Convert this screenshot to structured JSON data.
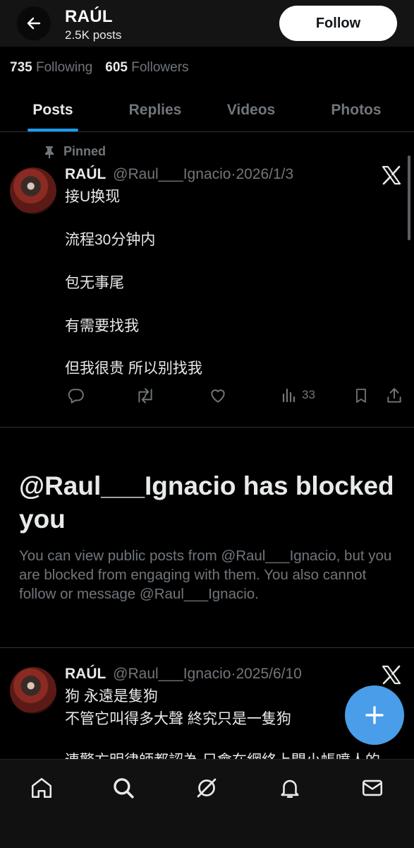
{
  "header": {
    "title": "RAÚL",
    "subtitle": "2.5K posts",
    "follow_label": "Follow"
  },
  "counts": {
    "following_count": "735",
    "following_label": "Following",
    "followers_count": "605",
    "followers_label": "Followers"
  },
  "tabs": [
    {
      "label": "Posts",
      "active": true
    },
    {
      "label": "Replies",
      "active": false
    },
    {
      "label": "Videos",
      "active": false
    },
    {
      "label": "Photos",
      "active": false
    }
  ],
  "pinned_post": {
    "pinned_label": "Pinned",
    "name": "RAÚL",
    "handle": "@Raul___Ignacio",
    "separator": "·",
    "date": "2026/1/3",
    "lines": [
      "接U换现",
      "流程30分钟内",
      "包无事尾",
      "有需要找我",
      "但我很贵 所以别找我"
    ],
    "views": "33"
  },
  "blocked": {
    "title": "@Raul___Ignacio has blocked you",
    "description": "You can view public posts from @Raul___Ignacio, but you are blocked from engaging with them. You also cannot follow or message @Raul___Ignacio."
  },
  "second_post": {
    "name": "RAÚL",
    "handle": "@Raul___Ignacio",
    "separator": "·",
    "date": "2025/6/10",
    "lines": [
      "狗 永遠是隻狗",
      "不管它叫得多大聲 終究只是一隻狗",
      "連警方明律師都認為 只會在網絡上開小帳噴人的"
    ]
  },
  "icons": {
    "back": "arrow-left-icon",
    "pin": "pin-icon",
    "x_logo": "x-logo-icon",
    "reply": "reply-icon",
    "repost": "repost-icon",
    "like": "heart-icon",
    "views": "analytics-icon",
    "bookmark": "bookmark-icon",
    "share": "share-icon",
    "compose": "plus-icon",
    "nav": [
      "home-icon",
      "search-icon",
      "grok-icon",
      "bell-icon",
      "mail-icon"
    ]
  },
  "colors": {
    "background": "#000000",
    "accent": "#1d9bf0",
    "fab": "#4a9de8",
    "secondary_text": "#71767b"
  }
}
